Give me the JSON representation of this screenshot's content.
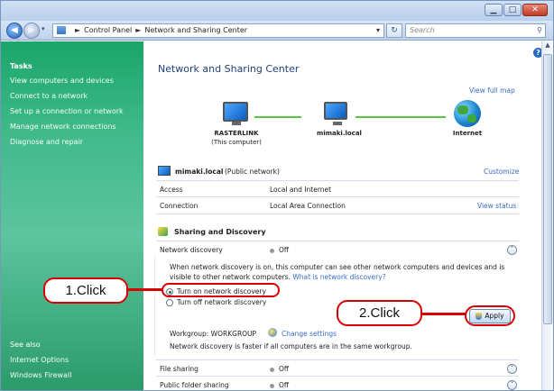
{
  "window": {
    "min_glyph": "▁",
    "max_glyph": "□",
    "close_glyph": "✕"
  },
  "address_bar": {
    "crumbs": [
      "Control Panel",
      "Network and Sharing Center"
    ],
    "separator": "►",
    "search_placeholder": "Search"
  },
  "sidebar": {
    "tasks_heading": "Tasks",
    "tasks": [
      "View computers and devices",
      "Connect to a network",
      "Set up a connection or network",
      "Manage network connections",
      "Diagnose and repair"
    ],
    "see_also_heading": "See also",
    "see_also": [
      "Internet Options",
      "Windows Firewall"
    ]
  },
  "main": {
    "title": "Network and Sharing Center",
    "view_full_map": "View full map",
    "map": {
      "computer_name": "RASTERLINK",
      "computer_sub": "(This computer)",
      "network_name": "mimaki.local",
      "internet_label": "Internet"
    },
    "network": {
      "name": "mimaki.local",
      "type": "(Public network)",
      "customize": "Customize",
      "access_label": "Access",
      "access_value": "Local and Internet",
      "connection_label": "Connection",
      "connection_value": "Local Area Connection",
      "view_status": "View status"
    },
    "sharing": {
      "heading": "Sharing and Discovery",
      "discovery_label": "Network discovery",
      "discovery_status": "Off",
      "description_1": "When network discovery is on, this computer can see other network computers and devices and is",
      "description_2a": "visible to other network computers.",
      "description_link": "What is network discovery?",
      "option_on": "Turn on network discovery",
      "option_off": "Turn off network discovery",
      "workgroup": "Workgroup: WORKGROUP",
      "change_settings": "Change settings",
      "workgroup_note": "Network discovery is faster if all computers are in the same workgroup.",
      "apply": "Apply",
      "file_sharing_label": "File sharing",
      "file_sharing_status": "Off",
      "public_folder_label": "Public folder sharing",
      "public_folder_status": "Off"
    }
  },
  "callouts": {
    "step1": "1.Click",
    "step2": "2.Click"
  },
  "colors": {
    "callout_red": "#d80000",
    "sidebar_green": "#2aab72",
    "link_blue": "#3a6bc6"
  }
}
